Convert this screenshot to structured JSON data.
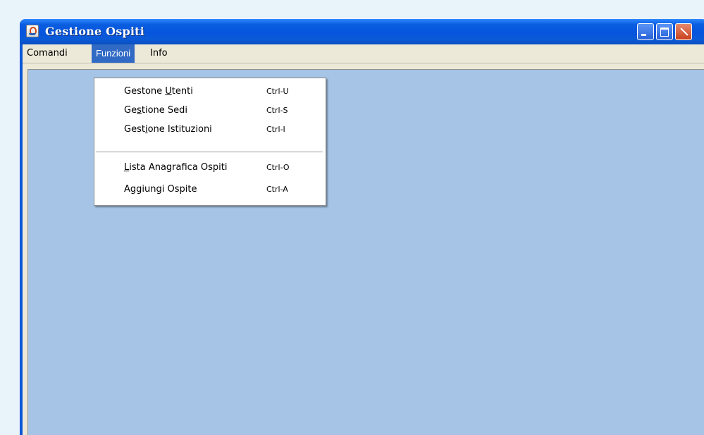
{
  "window": {
    "title": "Gestione Ospiti",
    "icon": "java-cup-icon",
    "controls": [
      "minimize-icon",
      "maximize-icon",
      "close-icon"
    ]
  },
  "menubar": {
    "items": [
      {
        "label": "Comandi"
      },
      {
        "label": "Funzioni",
        "state": "open"
      },
      {
        "label": "Info"
      }
    ]
  },
  "dropdown": {
    "items": [
      {
        "pre": "Gestone ",
        "mnemonic": "U",
        "post": "tenti",
        "shortcut": "Ctrl-U"
      },
      {
        "pre": "Ge",
        "mnemonic": "s",
        "post": "tione Sedi",
        "shortcut": "Ctrl-S"
      },
      {
        "pre": "Gest",
        "mnemonic": "i",
        "post": "one Istituzioni",
        "shortcut": "Ctrl-I"
      },
      {
        "pre": "",
        "mnemonic": "L",
        "post": "ista Anagrafica Ospiti",
        "shortcut": "Ctrl-O"
      },
      {
        "pre": "Aggiungi Ospite",
        "mnemonic": "",
        "post": "",
        "shortcut": "Ctrl-A"
      }
    ]
  },
  "colors": {
    "titlebar": "#0655de",
    "menu_highlight": "#316ac5",
    "desktop": "#a6c5e6",
    "chrome": "#ece9d8"
  }
}
